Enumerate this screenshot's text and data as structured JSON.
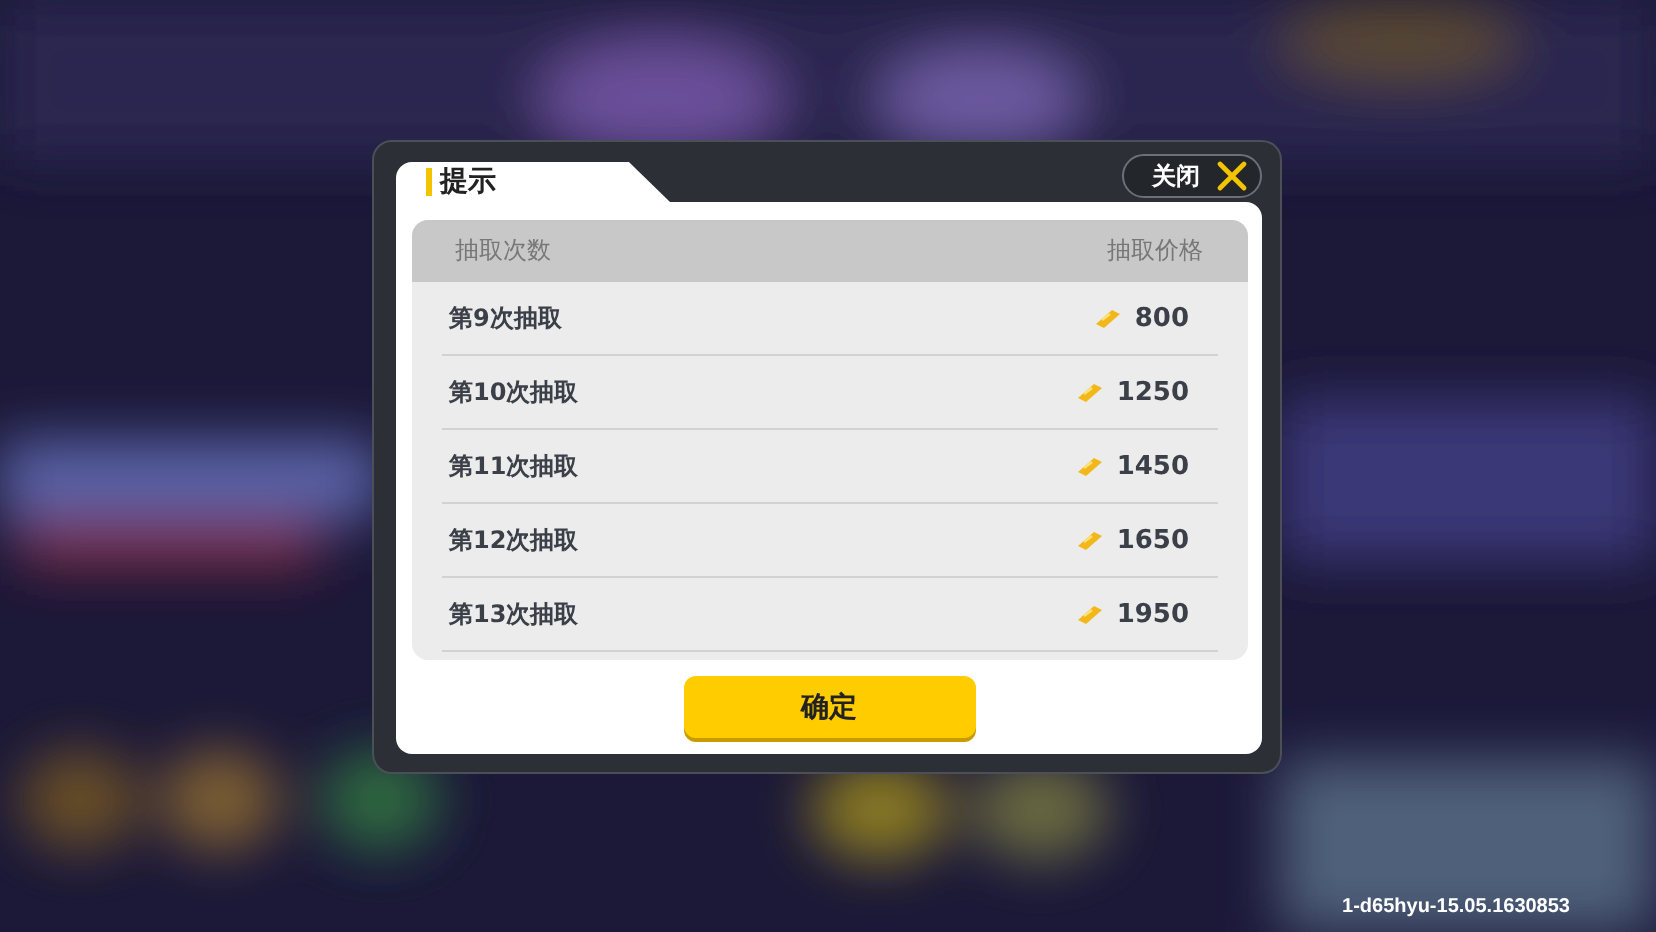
{
  "dialog": {
    "title": "提示",
    "close_label": "关闭",
    "table": {
      "columns": [
        "抽取次数",
        "抽取价格"
      ],
      "rows": [
        {
          "label": "第9次抽取",
          "price": "800"
        },
        {
          "label": "第10次抽取",
          "price": "1250"
        },
        {
          "label": "第11次抽取",
          "price": "1450"
        },
        {
          "label": "第12次抽取",
          "price": "1650"
        },
        {
          "label": "第13次抽取",
          "price": "1950"
        }
      ]
    },
    "confirm_button": "确定"
  },
  "build_info": "1-d65hyu-15.05.1630853"
}
